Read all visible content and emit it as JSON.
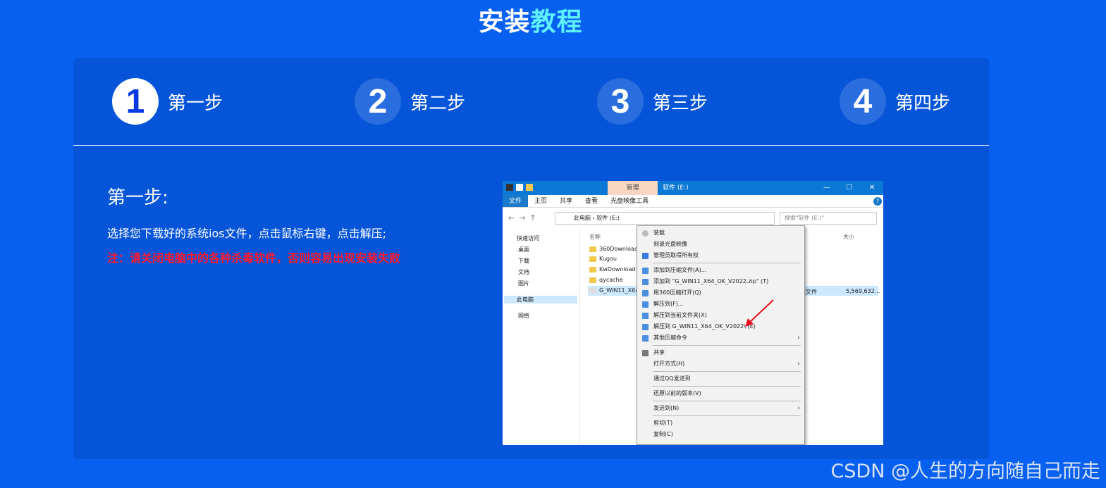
{
  "header": {
    "title_part1": "安装",
    "title_part2": "教程"
  },
  "steps": [
    {
      "number": "1",
      "label": "第一步",
      "active": true
    },
    {
      "number": "2",
      "label": "第二步",
      "active": false
    },
    {
      "number": "3",
      "label": "第三步",
      "active": false
    },
    {
      "number": "4",
      "label": "第四步",
      "active": false
    }
  ],
  "content": {
    "title": "第一步:",
    "description": "选择您下载好的系统ios文件，点击鼠标右键，点击解压;",
    "note": "注：请关闭电脑中的各种杀毒软件，否则容易出现安装失败"
  },
  "screenshot": {
    "manage_tab": "管理",
    "window_title": "软件 (E:)",
    "window_buttons": [
      "—",
      "☐",
      "✕"
    ],
    "ribbon_tabs": [
      "文件",
      "主页",
      "共享",
      "查看",
      "光盘映像工具"
    ],
    "address": "此电脑 › 软件 (E:)",
    "search_placeholder": "搜索\"软件 (E:)\"",
    "nav_items": [
      "快速访问",
      "桌面",
      "下载",
      "文档",
      "图片",
      "此电脑",
      "网络"
    ],
    "column_name": "名称",
    "column_size": "大小",
    "files": [
      "360Download",
      "Kugou",
      "KwDownload",
      "qycache",
      "G_WIN11_X64"
    ],
    "selected_file_type": "像文件",
    "selected_file_size": "5,569,632...",
    "context_menu": [
      "装载",
      "刻录光盘映像",
      "管理员取得所有权",
      "添加到压缩文件(A)...",
      "添加到 \"G_WIN11_X64_OK_V2022.zip\" (T)",
      "用360压缩打开(Q)",
      "解压到(F)...",
      "解压到当前文件夹(X)",
      "解压到 G_WIN11_X64_OK_V2022\\ (E)",
      "其他压缩命令",
      "共享",
      "打开方式(H)",
      "通过QQ发送到",
      "还原以前的版本(V)",
      "发送到(N)",
      "剪切(T)",
      "复制(C)"
    ]
  },
  "watermark": "CSDN @人生的方向随自己而走",
  "colors": {
    "background": "#0760f0",
    "panel": "#0655d9",
    "accent": "#5ff0ff",
    "note": "#ff1a2e"
  }
}
